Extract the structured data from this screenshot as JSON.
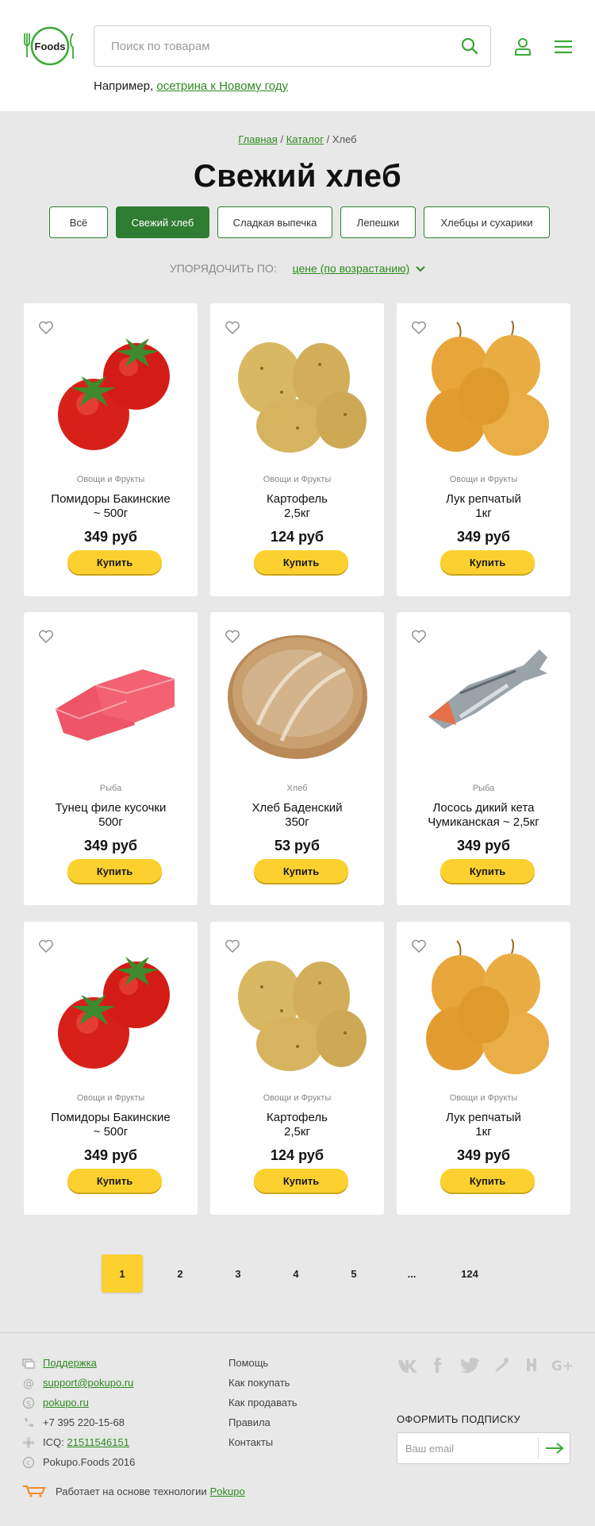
{
  "header": {
    "logo_text": "Foods",
    "search_placeholder": "Поиск по товарам",
    "example_prefix": "Например,",
    "example_link": "осетрина к Новому году"
  },
  "breadcrumb": {
    "home": "Главная",
    "separator": "/",
    "catalog": "Каталог",
    "current": "Хлеб"
  },
  "page_title": "Свежий хлеб",
  "filters": [
    {
      "label": "Всё",
      "active": false
    },
    {
      "label": "Свежий хлеб",
      "active": true
    },
    {
      "label": "Сладкая выпечка",
      "active": false
    },
    {
      "label": "Лепешки",
      "active": false
    },
    {
      "label": "Хлебцы и сухарики",
      "active": false
    }
  ],
  "sort": {
    "label": "УПОРЯДОЧИТЬ ПО:",
    "value": "цене (по возрастанию)"
  },
  "products": [
    {
      "category": "Овощи и Фрукты",
      "name_line1": "Помидоры Бакинские",
      "name_line2": "~ 500г",
      "price": "349 руб",
      "image": "tomato"
    },
    {
      "category": "Овощи и Фрукты",
      "name_line1": "Картофель",
      "name_line2": "2,5кг",
      "price": "124 руб",
      "image": "potato"
    },
    {
      "category": "Овощи и Фрукты",
      "name_line1": "Лук репчатый",
      "name_line2": "1кг",
      "price": "349 руб",
      "image": "onion"
    },
    {
      "category": "Рыба",
      "name_line1": "Тунец филе кусочки",
      "name_line2": "500г",
      "price": "349 руб",
      "image": "tuna"
    },
    {
      "category": "Хлеб",
      "name_line1": "Хлеб Баденский",
      "name_line2": "350г",
      "price": "53 руб",
      "image": "bread"
    },
    {
      "category": "Рыба",
      "name_line1": "Лосось дикий кета",
      "name_line2": "Чумиканская ~ 2,5кг",
      "price": "349 руб",
      "image": "salmon"
    },
    {
      "category": "Овощи и Фрукты",
      "name_line1": "Помидоры Бакинские",
      "name_line2": "~ 500г",
      "price": "349 руб",
      "image": "tomato"
    },
    {
      "category": "Овощи и Фрукты",
      "name_line1": "Картофель",
      "name_line2": "2,5кг",
      "price": "124 руб",
      "image": "potato"
    },
    {
      "category": "Овощи и Фрукты",
      "name_line1": "Лук репчатый",
      "name_line2": "1кг",
      "price": "349 руб",
      "image": "onion"
    }
  ],
  "buy_label": "Купить",
  "pagination": {
    "pages": [
      "1",
      "2",
      "3",
      "4",
      "5",
      "...",
      "124"
    ],
    "current": "1"
  },
  "footer": {
    "support": "Поддержка",
    "email": "support@pokupo.ru",
    "skype": "pokupo.ru",
    "phone": "+7 395 220-15-68",
    "icq_label": "ICQ:",
    "icq_number": "21511546151",
    "copyright": "Pokupo.Foods 2016",
    "links": [
      "Помощь",
      "Как покупать",
      "Как продавать",
      "Правила",
      "Контакты"
    ],
    "social": [
      "vk-icon",
      "facebook-icon",
      "twitter-icon",
      "odnoklassniki-icon",
      "hh-icon",
      "google-plus-icon"
    ],
    "subscribe_title": "ОФОРМИТЬ ПОДПИСКУ",
    "subscribe_placeholder": "Ваш email",
    "powered_text": "Работает на основе технологии",
    "powered_link": "Pokupo"
  },
  "colors": {
    "brand_green": "#2e7d32",
    "link_green": "#2e8b1f",
    "buy_yellow": "#fcd12f",
    "page_bg": "#e8e8e8"
  }
}
